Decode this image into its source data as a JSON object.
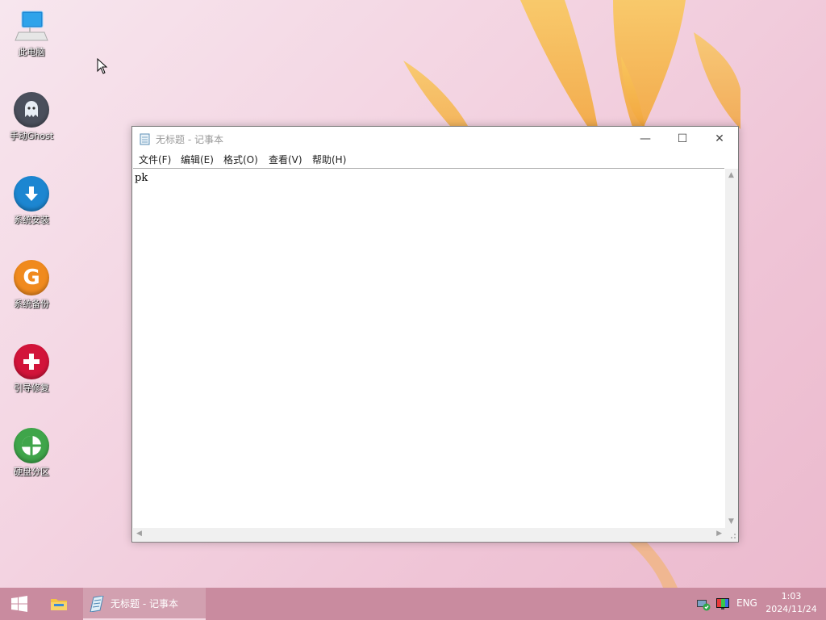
{
  "desktop": {
    "icons": [
      {
        "label": "此电脑",
        "icon": "computer-icon"
      },
      {
        "label": "手动Ghost",
        "icon": "ghost-icon"
      },
      {
        "label": "系统安装",
        "icon": "download-arrow-icon"
      },
      {
        "label": "系统备份",
        "icon": "g-letter-icon"
      },
      {
        "label": "引导修复",
        "icon": "plus-icon"
      },
      {
        "label": "硬盘分区",
        "icon": "partition-icon"
      }
    ]
  },
  "notepad": {
    "title": "无标题 - 记事本",
    "menu": [
      "文件(F)",
      "编辑(E)",
      "格式(O)",
      "查看(V)",
      "帮助(H)"
    ],
    "content": "pk",
    "buttons": {
      "minimize": "—",
      "maximize": "☐",
      "close": "✕"
    }
  },
  "taskbar": {
    "notepad_label": "无标题 - 记事本",
    "language": "ENG",
    "time": "1:03",
    "date": "2024/11/24"
  },
  "colors": {
    "taskbar": "#c98b9f",
    "wallpaper_flower": "#f6b43a"
  }
}
